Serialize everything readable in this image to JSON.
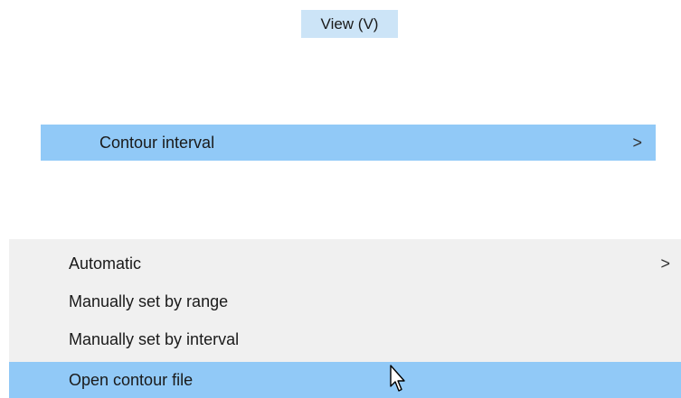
{
  "menubar": {
    "view_label": "View (V)"
  },
  "view_submenu": {
    "contour_interval_label": "Contour interval",
    "contour_interval_arrow": ">"
  },
  "contour_interval_popup": {
    "items": [
      {
        "label": "Automatic",
        "arrow": ">"
      },
      {
        "label": "Manually set by range",
        "arrow": ""
      },
      {
        "label": "Manually set by interval",
        "arrow": ""
      },
      {
        "label": "Open contour file",
        "arrow": ""
      }
    ]
  },
  "cursor": {
    "icon": "mouse-pointer-icon"
  }
}
